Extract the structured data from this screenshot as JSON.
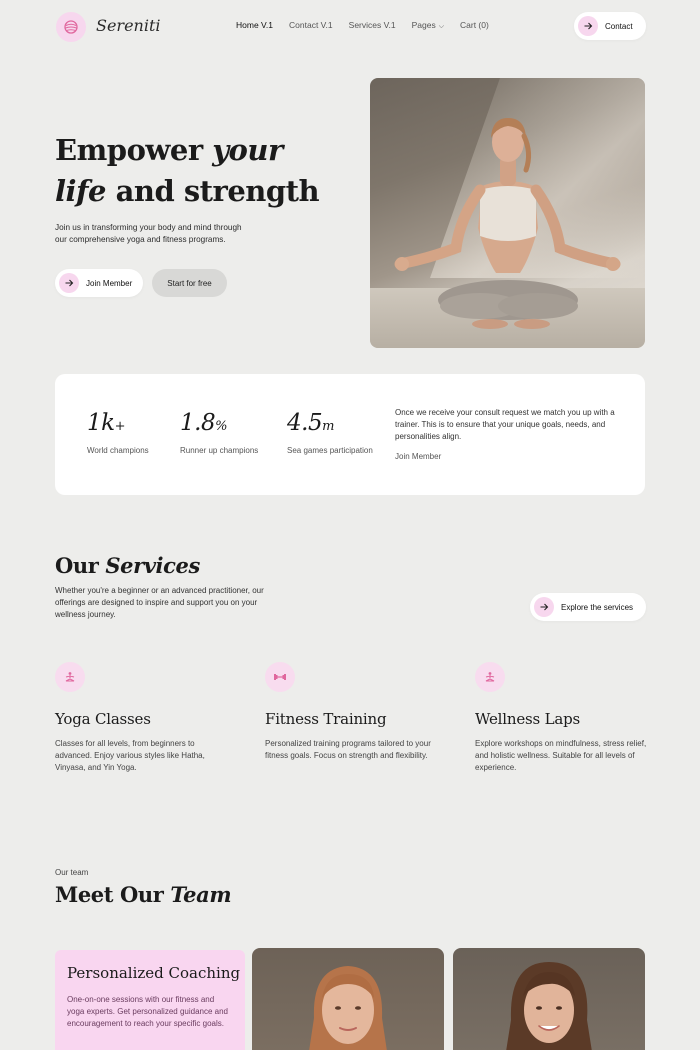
{
  "nav": {
    "brand": "Sereniti",
    "items": [
      "Home V.1",
      "Contact V.1",
      "Services V.1",
      "Pages",
      "Cart (0)"
    ],
    "contact_label": "Contact"
  },
  "hero": {
    "title_part1": "Empower ",
    "title_italic1": "your",
    "title_italic2": "life",
    "title_part2": " and strength",
    "description": "Join us in transforming your body and mind through our comprehensive yoga and fitness programs.",
    "join_label": "Join Member",
    "start_label": "Start for free"
  },
  "stats": {
    "items": [
      {
        "value": "1k",
        "suffix": "+",
        "label": "World champions"
      },
      {
        "value": "1.8",
        "suffix": "%",
        "label": "Runner up champions"
      },
      {
        "value": "4.5",
        "suffix": "m",
        "label": "Sea games participation"
      }
    ],
    "description": "Once we receive your consult request we match you up with a trainer. This is to ensure that your unique goals, needs, and personalities align.",
    "join_label": "Join Member"
  },
  "services": {
    "title_plain": "Our ",
    "title_italic": "Services",
    "description": "Whether you're a beginner or an advanced practitioner, our offerings are designed to inspire and support you on your wellness journey.",
    "explore_label": "Explore the services",
    "items": [
      {
        "title": "Yoga Classes",
        "description": "Classes for all levels, from beginners to advanced. Enjoy various styles like Hatha, Vinyasa, and Yin Yoga."
      },
      {
        "title": "Fitness Training",
        "description": "Personalized training programs tailored to your fitness goals. Focus on strength and flexibility."
      },
      {
        "title": "Wellness Laps",
        "description": "Explore workshops on mindfulness, stress relief, and holistic wellness. Suitable for all levels of experience."
      }
    ]
  },
  "team": {
    "eyebrow": "Our team",
    "title_plain": "Meet Our ",
    "title_italic": "Team",
    "coach_title": "Personalized Coaching",
    "coach_description": "One-on-one sessions with our fitness and yoga experts. Get personalized guidance and encouragement to reach your specific goals."
  },
  "colors": {
    "background": "#ededeb",
    "accent_pink": "#f7d7ee",
    "icon_pink": "#e0679e"
  }
}
